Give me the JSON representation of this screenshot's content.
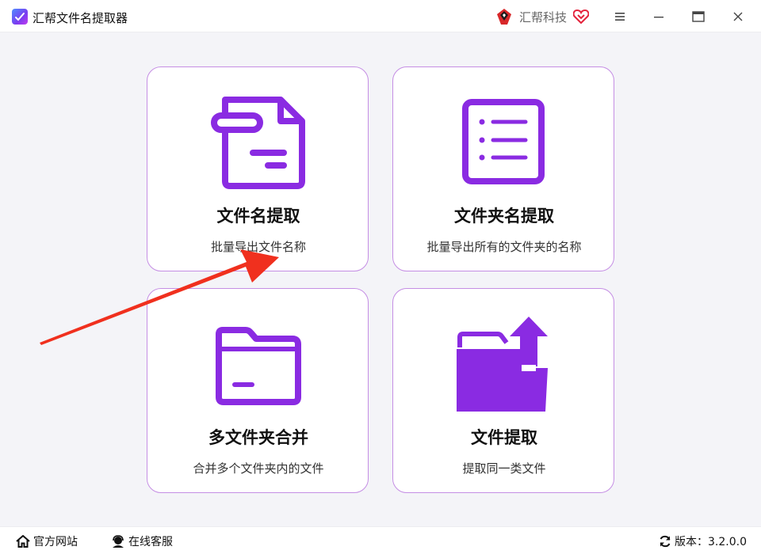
{
  "window": {
    "title": "汇帮文件名提取器",
    "brand": "汇帮科技"
  },
  "cards": [
    {
      "title": "文件名提取",
      "description": "批量导出文件名称",
      "icon": "document-icon"
    },
    {
      "title": "文件夹名提取",
      "description": "批量导出所有的文件夹的名称",
      "icon": "list-icon"
    },
    {
      "title": "多文件夹合并",
      "description": "合并多个文件夹内的文件",
      "icon": "folder-icon"
    },
    {
      "title": "文件提取",
      "description": "提取同一类文件",
      "icon": "folder-upload-icon"
    }
  ],
  "statusbar": {
    "website": "官方网站",
    "support": "在线客服",
    "version": "版本：3.2.0.0"
  },
  "colors": {
    "accent": "#8a2be2",
    "card_border": "#c58ee4",
    "annotation_arrow": "#f0301e"
  }
}
